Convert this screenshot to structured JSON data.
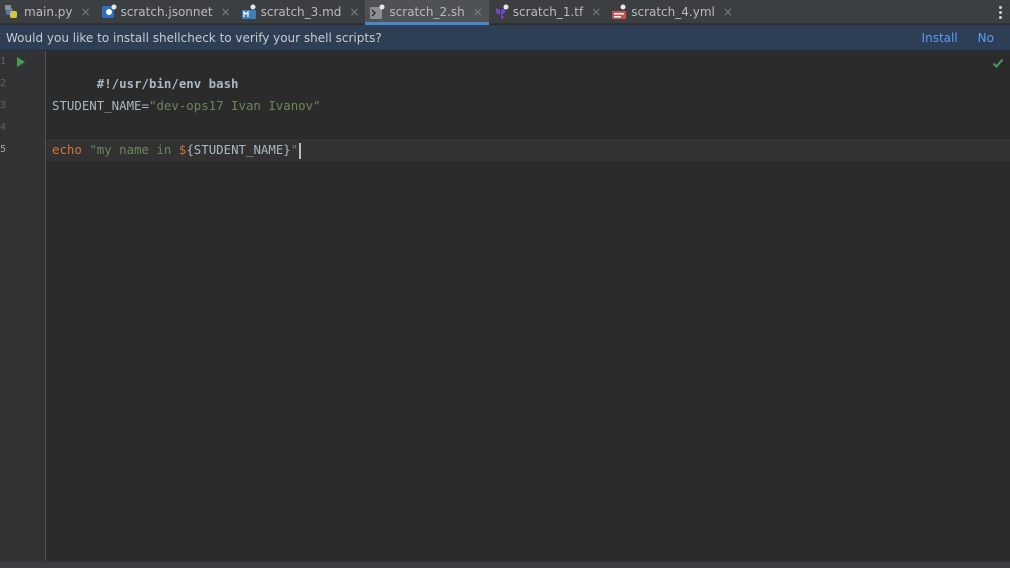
{
  "tabs": [
    {
      "label": "main.py",
      "icon": "python-file-icon",
      "active": false
    },
    {
      "label": "scratch.jsonnet",
      "icon": "jsonnet-file-icon",
      "active": false
    },
    {
      "label": "scratch_3.md",
      "icon": "markdown-file-icon",
      "active": false
    },
    {
      "label": "scratch_2.sh",
      "icon": "shell-file-icon",
      "active": true
    },
    {
      "label": "scratch_1.tf",
      "icon": "terraform-file-icon",
      "active": false
    },
    {
      "label": "scratch_4.yml",
      "icon": "yaml-file-icon",
      "active": false
    }
  ],
  "tab_close_glyph": "×",
  "banner": {
    "message": "Would you like to install shellcheck to verify your shell scripts?",
    "install_label": "Install",
    "no_label": "No"
  },
  "editor": {
    "line_numbers": [
      "1",
      "2",
      "3",
      "4",
      "5"
    ],
    "current_line": 5,
    "lines": {
      "l1": "#!/usr/bin/env bash",
      "l3_var": "STUDENT_NAME=",
      "l3_str": "\"dev-ops17 Ivan Ivanov\"",
      "l5_kw": "echo",
      "l5_space": " ",
      "l5_str_open": "\"my name in ",
      "l5_dollar": "$",
      "l5_var": "{STUDENT_NAME}",
      "l5_str_close": "\""
    }
  },
  "colors": {
    "accent": "#4a88c7",
    "keyword": "#cc7832",
    "string": "#6a8759",
    "link": "#589df6",
    "ok_check": "#499c54"
  }
}
